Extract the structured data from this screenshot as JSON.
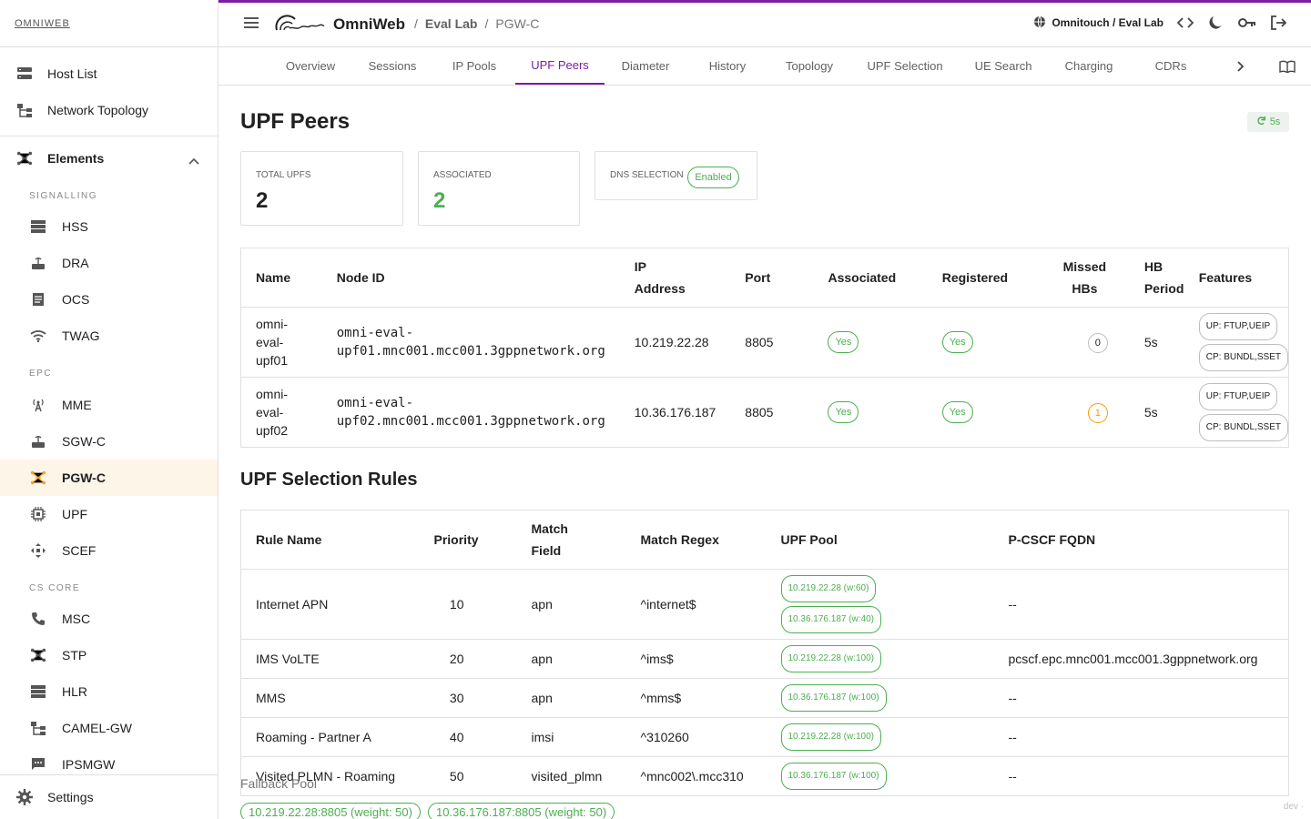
{
  "sidebar": {
    "brand": "OMNIWEB",
    "host_list": "Host List",
    "network_topology": "Network Topology",
    "elements": "Elements",
    "section_signalling": "SIGNALLING",
    "section_epc": "EPC",
    "section_cs_core": "CS CORE",
    "items": {
      "hss": "HSS",
      "dra": "DRA",
      "ocs": "OCS",
      "twag": "TWAG",
      "mme": "MME",
      "sgwc": "SGW-C",
      "pgwc": "PGW-C",
      "upf": "UPF",
      "scef": "SCEF",
      "msc": "MSC",
      "stp": "STP",
      "hlr": "HLR",
      "camel_gw": "CAMEL-GW",
      "ipsmgw": "IPSMGW"
    },
    "settings": "Settings",
    "active_color": "#f5a623"
  },
  "topbar": {
    "app_name": "OmniWeb",
    "crumb_1": "Eval Lab",
    "crumb_2": "PGW-C",
    "tenant": "Omnitouch / Eval Lab",
    "accent": "#7b1fa2"
  },
  "tabs": {
    "overview": "Overview",
    "sessions": "Sessions",
    "ip_pools": "IP Pools",
    "upf_peers": "UPF Peers",
    "diameter": "Diameter",
    "history": "History",
    "topology": "Topology",
    "upf_selection": "UPF Selection",
    "ue_search": "UE Search",
    "charging": "Charging",
    "cdrs": "CDRs"
  },
  "main": {
    "title": "UPF Peers",
    "refresh": "5s",
    "cards": {
      "total_label": "TOTAL UPFS",
      "total_value": "2",
      "assoc_label": "ASSOCIATED",
      "assoc_value": "2",
      "dns_label": "DNS SELECTION",
      "dns_value": "Enabled"
    },
    "peers_headers": {
      "name": "Name",
      "node_id": "Node ID",
      "ip_1": "IP",
      "ip_2": "Address",
      "port": "Port",
      "associated": "Associated",
      "registered": "Registered",
      "missed_1": "Missed",
      "missed_2": "HBs",
      "hb_1": "HB",
      "hb_2": "Period",
      "features": "Features"
    },
    "peers": [
      {
        "name_1": "omni-",
        "name_2": "eval-",
        "name_3": "upf01",
        "node_1": "omni-eval-",
        "node_2": "upf01.mnc001.mcc001.3gppnetwork.org",
        "ip": "10.219.22.28",
        "port": "8805",
        "associated": "Yes",
        "registered": "Yes",
        "missed": "0",
        "hb": "5s",
        "feat_up": "UP: FTUP,UEIP",
        "feat_cp": "CP: BUNDL,SSET"
      },
      {
        "name_1": "omni-",
        "name_2": "eval-",
        "name_3": "upf02",
        "node_1": "omni-eval-",
        "node_2": "upf02.mnc001.mcc001.3gppnetwork.org",
        "ip": "10.36.176.187",
        "port": "8805",
        "associated": "Yes",
        "registered": "Yes",
        "missed": "1",
        "hb": "5s",
        "feat_up": "UP: FTUP,UEIP",
        "feat_cp": "CP: BUNDL,SSET"
      }
    ],
    "rules_title": "UPF Selection Rules",
    "rules_headers": {
      "rule_name": "Rule Name",
      "priority": "Priority",
      "match_field_1": "Match",
      "match_field_2": "Field",
      "match_regex": "Match Regex",
      "upf_pool": "UPF Pool",
      "pcscf": "P-CSCF FQDN"
    },
    "rules": [
      {
        "name": "Internet APN",
        "priority": "10",
        "field": "apn",
        "regex": "^internet$",
        "pool_1": "10.219.22.28 (w:60)",
        "pool_2": "10.36.176.187 (w:40)",
        "pcscf": "--"
      },
      {
        "name": "IMS VoLTE",
        "priority": "20",
        "field": "apn",
        "regex": "^ims$",
        "pool_1": "10.219.22.28 (w:100)",
        "pcscf": "pcscf.epc.mnc001.mcc001.3gppnetwork.org"
      },
      {
        "name": "MMS",
        "priority": "30",
        "field": "apn",
        "regex": "^mms$",
        "pool_1": "10.36.176.187 (w:100)",
        "pcscf": "--"
      },
      {
        "name": "Roaming - Partner A",
        "priority": "40",
        "field": "imsi",
        "regex": "^310260",
        "pool_1": "10.219.22.28 (w:100)",
        "pcscf": "--"
      },
      {
        "name": "Visited PLMN - Roaming",
        "priority": "50",
        "field": "visited_plmn",
        "regex": "^mnc002\\.mcc310",
        "pool_1": "10.36.176.187 (w:100)",
        "pcscf": "--"
      }
    ],
    "fallback_label": "Fallback Pool",
    "fallback_1": "10.219.22.28:8805 (weight: 50)",
    "fallback_2": "10.36.176.187:8805 (weight: 50)",
    "dev_tag": "dev ·"
  }
}
